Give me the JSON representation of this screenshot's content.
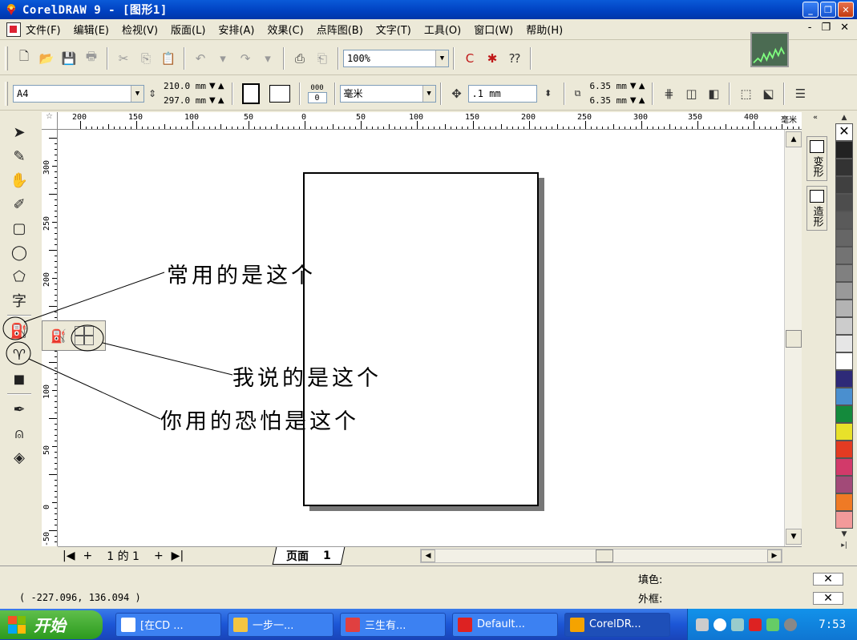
{
  "window": {
    "title": "CorelDRAW 9 - [图形1]",
    "buttons": {
      "minimize": "_",
      "restore": "❐",
      "close": "✕"
    }
  },
  "menubar": {
    "items": [
      "文件(F)",
      "编辑(E)",
      "检视(V)",
      "版面(L)",
      "安排(A)",
      "效果(C)",
      "点阵图(B)",
      "文字(T)",
      "工具(O)",
      "窗口(W)",
      "帮助(H)"
    ],
    "doc_controls": {
      "minimize": "-",
      "restore": "❐",
      "close": "✕"
    }
  },
  "toolbar_standard": {
    "zoom_value": "100%"
  },
  "toolbar_property": {
    "paper_size": "A4",
    "width": "210.0 mm",
    "height": "297.0 mm",
    "units": "毫米",
    "nudge": ".1 mm",
    "dup_x": "6.35 mm",
    "dup_y": "6.35 mm",
    "page_count_box": "0",
    "page_count_label": "000"
  },
  "rulers": {
    "top_labels": [
      "200",
      "150",
      "100",
      "50",
      "0",
      "50",
      "100",
      "150",
      "200",
      "250",
      "300",
      "350",
      "400"
    ],
    "top_unit": "毫米",
    "left_labels": [
      "300",
      "250",
      "200",
      "150",
      "100",
      "50",
      "0",
      "-50"
    ],
    "corner": "☆"
  },
  "page_nav": {
    "first": "|◀",
    "add_before": "+",
    "counter": "1 的 1",
    "add_after": "+",
    "last": "▶|",
    "tab_label": "页面",
    "tab_number": "1"
  },
  "docker": {
    "tabs": [
      "变形",
      "造形"
    ]
  },
  "palette": {
    "colors": [
      "#222222",
      "#333333",
      "#404040",
      "#4d4d4d",
      "#5a5a5a",
      "#666666",
      "#737373",
      "#808080",
      "#999999",
      "#b3b3b3",
      "#cccccc",
      "#e6e6e6",
      "#ffffff",
      "#2e2a78",
      "#4a8fcf",
      "#148a3c",
      "#e8e12a",
      "#e33b22",
      "#d23a6a",
      "#a24a78",
      "#ef7a25",
      "#f29a9a"
    ]
  },
  "statusbar": {
    "coords": "( -227.096, 136.094 )",
    "fill_label": "填色:",
    "outline_label": "外框:",
    "fill_value": "✕",
    "outline_value": "✕"
  },
  "annotations": {
    "common": "常用的是这个",
    "mine": "我说的是这个",
    "yours": "你用的恐怕是这个"
  },
  "taskbar": {
    "start": "开始",
    "tasks": [
      "[在CD ...",
      "一步一...",
      "三生有...",
      "Default...",
      "CorelDR..."
    ],
    "clock": "7:53"
  }
}
